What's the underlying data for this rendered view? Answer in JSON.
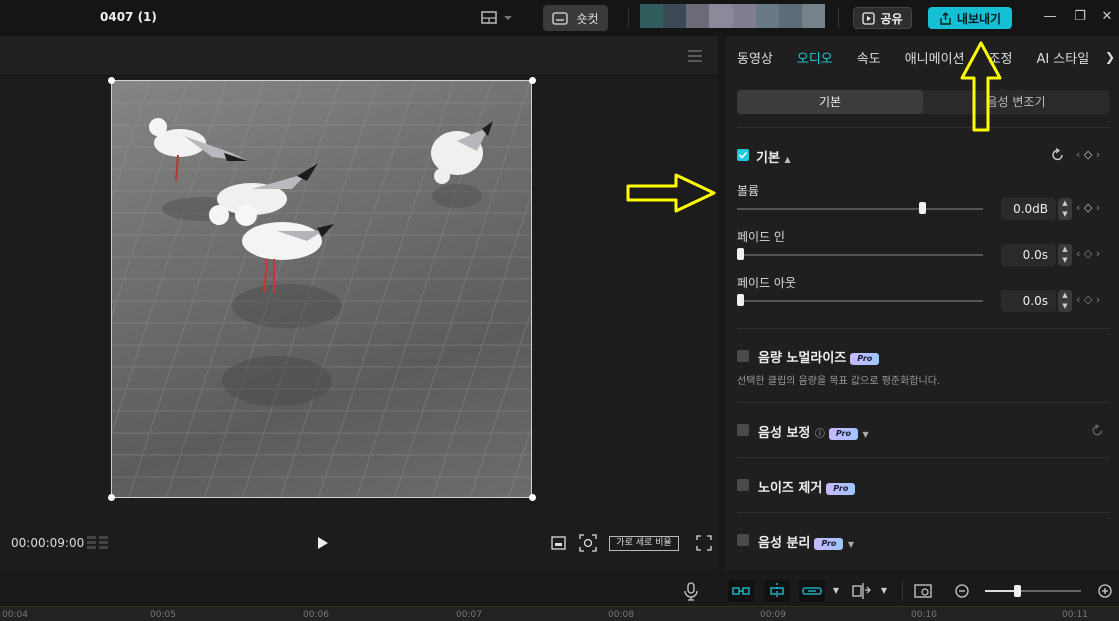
{
  "titlebar": {
    "title": "0407 (1)",
    "shortcut_label": "숏컷",
    "share_label": "공유",
    "export_label": "내보내기",
    "blur_colors": [
      "#2f5e5c",
      "#3d4a55",
      "#6b6b78",
      "#8b8a9a",
      "#7f7e92",
      "#6a7986",
      "#5b6e77",
      "#77818a"
    ]
  },
  "player": {
    "timecode": "00:00:09:00",
    "ratio_label": "가로 세로 비율"
  },
  "inspector": {
    "tabs": [
      "동영상",
      "오디오",
      "속도",
      "애니메이션",
      "조정",
      "AI 스타일"
    ],
    "active_tab": "오디오",
    "segments": [
      "기본",
      "음성 변조기"
    ],
    "basic": {
      "title": "기본",
      "volume_label": "볼륨",
      "volume_value": "0.0dB",
      "volume_level": 0.75,
      "fade_in_label": "페이드 인",
      "fade_in_value": "0.0s",
      "fade_out_label": "페이드 아웃",
      "fade_out_value": "0.0s"
    },
    "normalize": {
      "title": "음량 노멀라이즈",
      "badge": "Pro",
      "description": "선택한 클립의 음량을 목표 값으로 평준화합니다."
    },
    "enhance": {
      "title": "음성 보정",
      "badge": "Pro"
    },
    "denoise": {
      "title": "노이즈 제거",
      "badge": "Pro"
    },
    "separate": {
      "title": "음성 분리",
      "badge": "Pro"
    }
  },
  "timeline": {
    "ticks": [
      "00:04",
      "00:05",
      "00:06",
      "00:07",
      "00:08",
      "00:09",
      "00:10",
      "00:11"
    ],
    "accent": "#22c9dd"
  },
  "colors": {
    "accent": "#22c9dd",
    "annotation": "#ffff00"
  }
}
